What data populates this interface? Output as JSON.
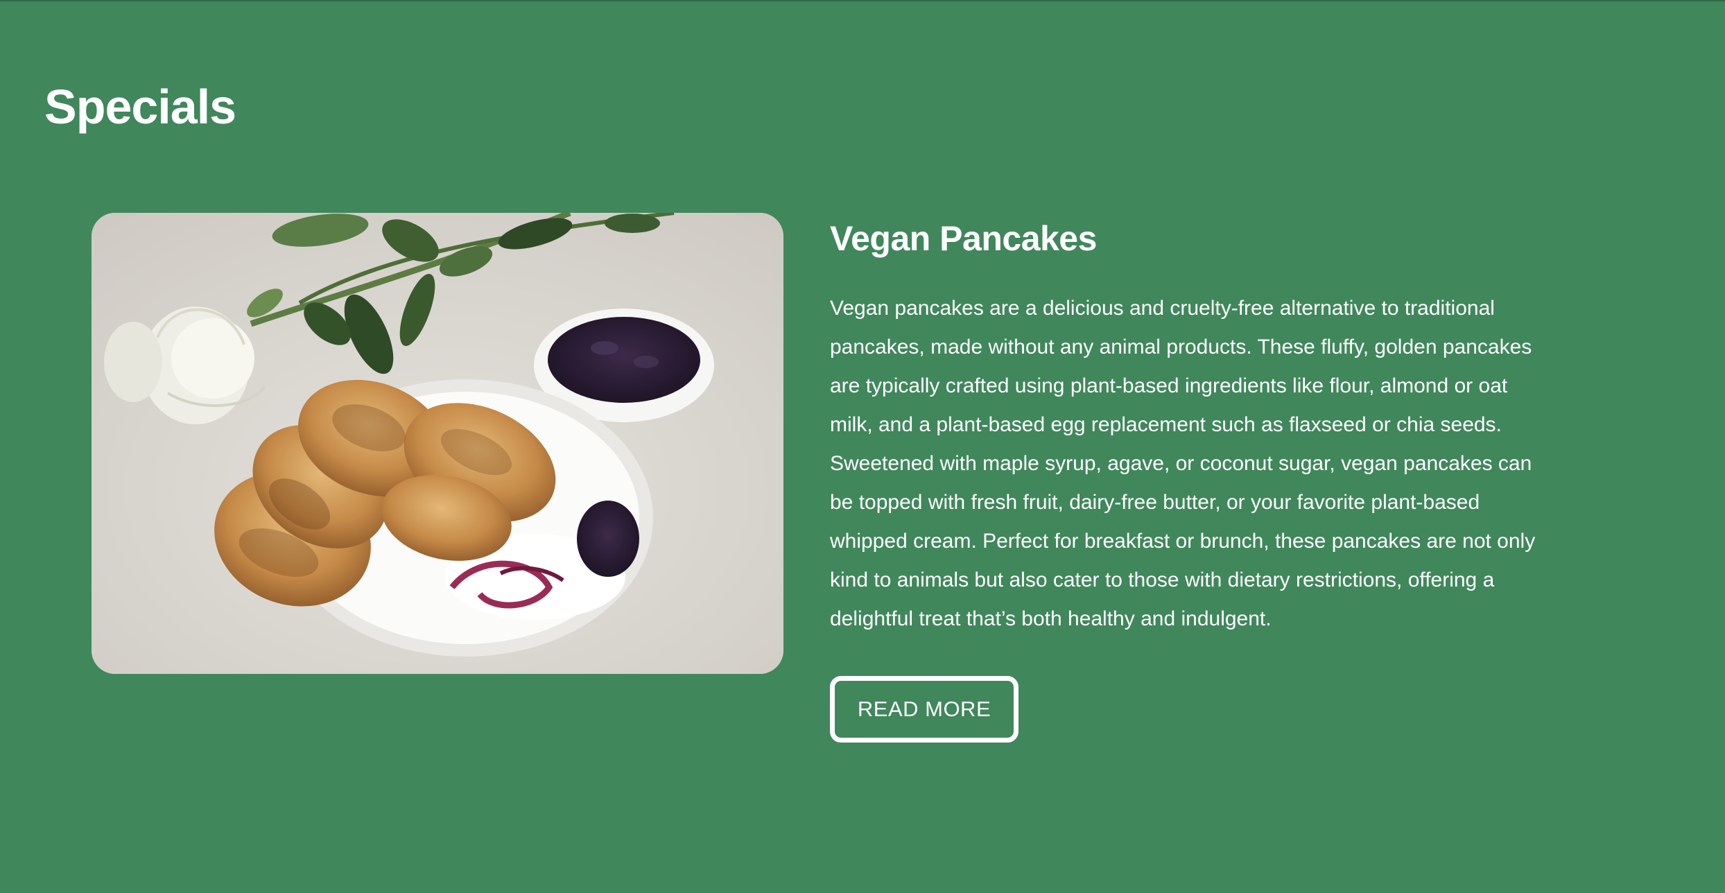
{
  "section": {
    "title": "Specials"
  },
  "special": {
    "name": "Vegan Pancakes",
    "description": "Vegan pancakes are a delicious and cruelty-free alternative to traditional pancakes, made without any animal products. These fluffy, golden pancakes are typically crafted using plant-based ingredients like flour, almond or oat milk, and a plant-based egg replacement such as flaxseed or chia seeds. Sweetened with maple syrup, agave, or coconut sugar, vegan pancakes can be topped with fresh fruit, dairy-free butter, or your favorite plant-based whipped cream. Perfect for breakfast or brunch, these pancakes are not only kind to animals but also cater to those with dietary restrictions, offering a delightful treat that’s both healthy and indulgent.",
    "button_label": "READ MORE"
  },
  "colors": {
    "background": "#40875c",
    "text": "#ffffff"
  }
}
